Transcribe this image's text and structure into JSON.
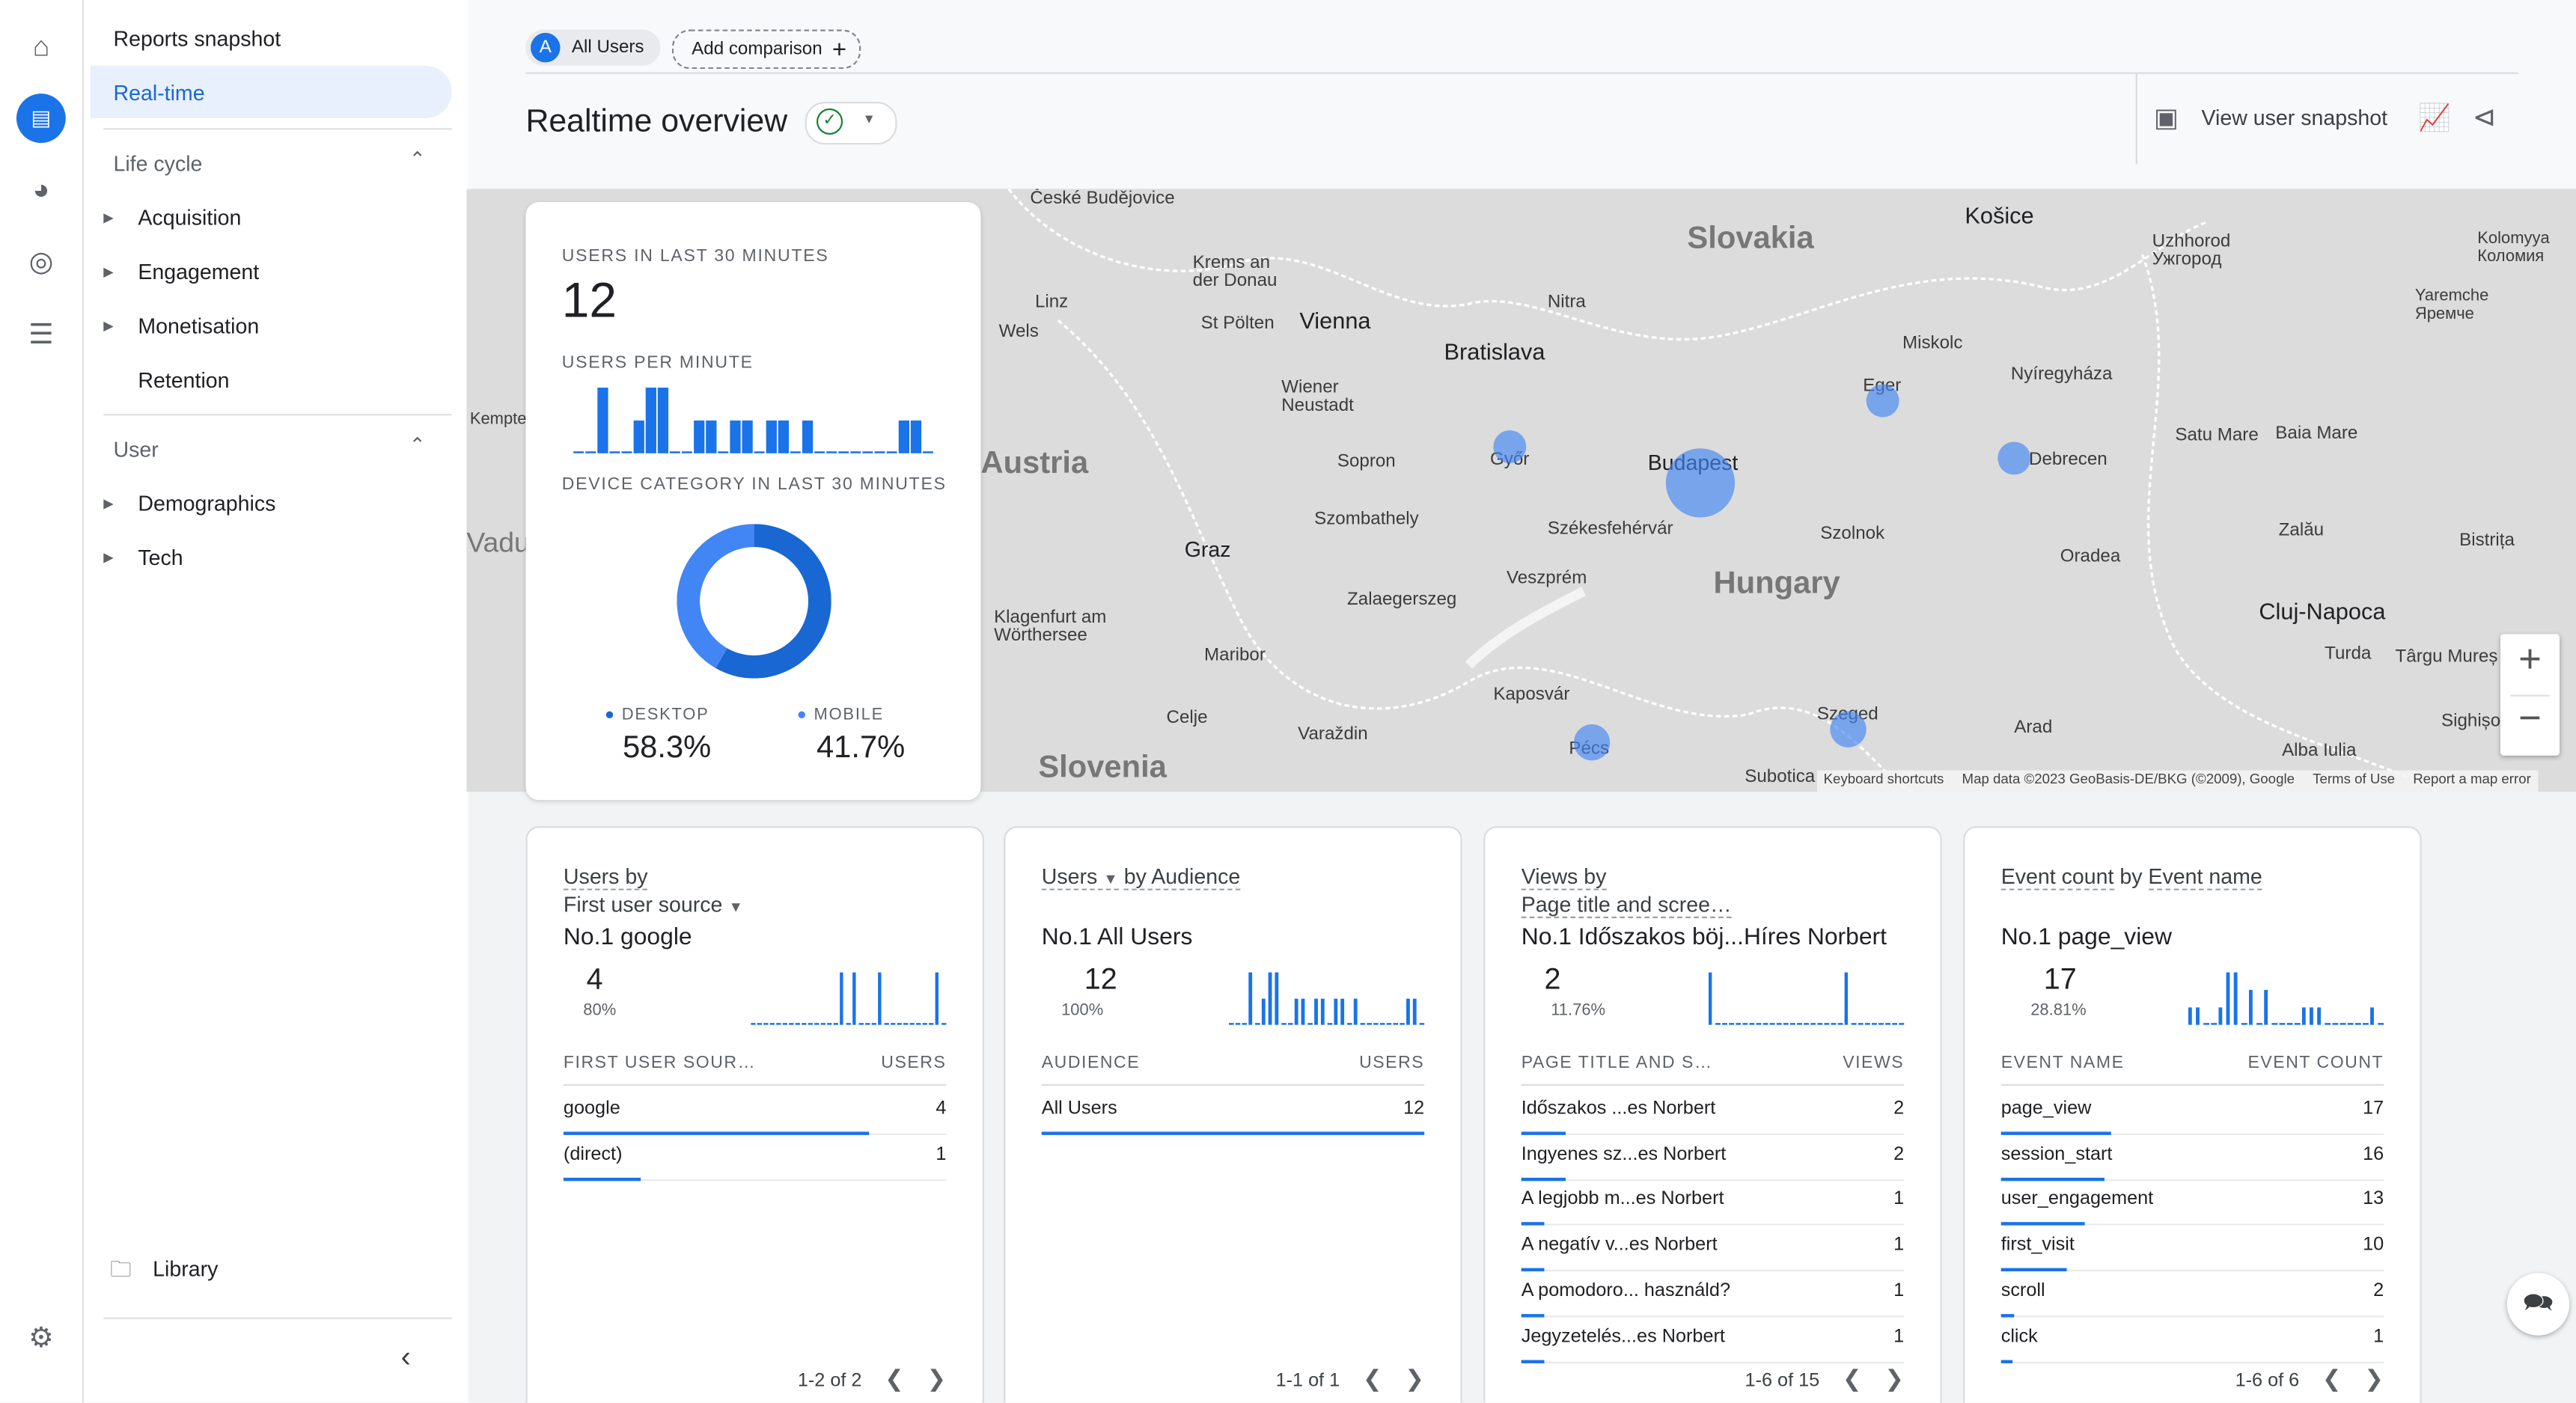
{
  "sidebar": {
    "title": "Reports snapshot",
    "selected": "Real-time",
    "lifecycle": {
      "label": "Life cycle",
      "items": [
        "Acquisition",
        "Engagement",
        "Monetisation",
        "Retention"
      ]
    },
    "user": {
      "label": "User",
      "items": [
        "Demographics",
        "Tech"
      ]
    },
    "library": "Library"
  },
  "header": {
    "comparison_chip": "All Users",
    "chip_letter": "A",
    "add_comparison": "Add comparison",
    "title": "Realtime overview",
    "view_user_snapshot": "View user snapshot"
  },
  "map": {
    "countries": [
      "Slovakia",
      "Austria",
      "Hungary",
      "Slovenia"
    ],
    "cities": [
      "České Budějovice",
      "Krems an der Donau",
      "Linz",
      "Wels",
      "St Pölten",
      "Vienna",
      "Bratislava",
      "Nitra",
      "Košice",
      "Uzhhorod Ужгород",
      "Kolomyya Коломия",
      "Yaremche Яремче",
      "Miskolc",
      "Eger",
      "Nyíregyháza",
      "Wiener Neustadt",
      "Sopron",
      "Győr",
      "Budapest",
      "Debrecen",
      "Satu Mare",
      "Baia Mare",
      "Graz",
      "Szombathely",
      "Székesfehérvár",
      "Szolnok",
      "Oradea",
      "Zalău",
      "Bistrița",
      "Veszprém",
      "Zalaegerszeg",
      "Cluj-Napoca",
      "Klagenfurt am Wörthersee",
      "Maribor",
      "Turda",
      "Târgu Mureș",
      "Kaposvár",
      "Szeged",
      "Arad",
      "Celje",
      "Varaždin",
      "Pécs",
      "Alba Iulia",
      "Sighișoara",
      "Subotica",
      "Kempten",
      "Vaduz"
    ],
    "footer": [
      "Keyboard shortcuts",
      "Map data ©2023 GeoBasis-DE/BKG (©2009), Google",
      "Terms of Use",
      "Report a map error"
    ],
    "bubbles": [
      {
        "city": "Budapest"
      },
      {
        "city": "Győr"
      },
      {
        "city": "Eger"
      },
      {
        "city": "Debrecen"
      },
      {
        "city": "Szeged"
      },
      {
        "city": "Pécs"
      }
    ]
  },
  "overview": {
    "users_label": "USERS IN LAST 30 MINUTES",
    "users_value": "12",
    "per_minute_label": "USERS PER MINUTE",
    "per_minute": [
      0,
      0,
      2,
      0,
      0,
      1,
      2,
      2,
      0,
      0,
      1,
      1,
      0,
      1,
      1,
      0,
      1,
      1,
      0,
      1,
      0,
      0,
      0,
      0,
      0,
      0,
      0,
      1,
      1,
      0
    ],
    "device_label": "DEVICE CATEGORY IN LAST 30 MINUTES",
    "devices": [
      {
        "name": "DESKTOP",
        "value": "58.3%",
        "share": 58.3,
        "color": "#1967d2"
      },
      {
        "name": "MOBILE",
        "value": "41.7%",
        "share": 41.7,
        "color": "#4285f4"
      }
    ]
  },
  "cards": [
    {
      "title_a": "Users by",
      "title_b": "First user source",
      "no1": "No.1  google",
      "big": "4",
      "pct": "80%",
      "col1": "FIRST USER SOUR…",
      "col2": "USERS",
      "spark": [
        0,
        0,
        0,
        0,
        0,
        0,
        0,
        0,
        0,
        0,
        0,
        0,
        0,
        0,
        1,
        0,
        1,
        0,
        0,
        0,
        1,
        0,
        0,
        0,
        0,
        0,
        0,
        0,
        0,
        1,
        0
      ],
      "rows": [
        {
          "name": "google",
          "value": "4",
          "share": 0.8
        },
        {
          "name": "(direct)",
          "value": "1",
          "share": 0.2
        }
      ],
      "pagination": "1-2 of 2"
    },
    {
      "title_a": "Users",
      "title_b": "by Audience",
      "no1": "No.1  All Users",
      "big": "12",
      "pct": "100%",
      "col1": "AUDIENCE",
      "col2": "USERS",
      "spark": [
        0,
        0,
        0,
        2,
        0,
        1,
        2,
        2,
        0,
        0,
        1,
        1,
        0,
        1,
        1,
        0,
        1,
        1,
        0,
        1,
        0,
        0,
        0,
        0,
        0,
        0,
        0,
        1,
        1,
        0
      ],
      "rows": [
        {
          "name": "All Users",
          "value": "12",
          "share": 1
        }
      ],
      "pagination": "1-1 of 1"
    },
    {
      "title_a": "Views by",
      "title_b": "Page title and scree…",
      "no1": "No.1  Időszakos böj...Híres Norbert",
      "big": "2",
      "pct": "11.76%",
      "col1": "PAGE TITLE AND S…",
      "col2": "VIEWS",
      "spark": [
        1,
        0,
        0,
        0,
        0,
        0,
        0,
        0,
        0,
        0,
        0,
        0,
        0,
        0,
        0,
        0,
        0,
        0,
        0,
        0,
        1,
        0,
        0,
        0,
        0,
        0,
        0,
        0,
        0
      ],
      "rows": [
        {
          "name": "Időszakos ...es Norbert",
          "value": "2",
          "share": 0.118
        },
        {
          "name": "Ingyenes sz...es Norbert",
          "value": "2",
          "share": 0.118
        },
        {
          "name": "A legjobb m...es Norbert",
          "value": "1",
          "share": 0.059
        },
        {
          "name": "A negatív v...es Norbert",
          "value": "1",
          "share": 0.059
        },
        {
          "name": "A pomodoro... használd?",
          "value": "1",
          "share": 0.059
        },
        {
          "name": "Jegyzetelés...es Norbert",
          "value": "1",
          "share": 0.059
        }
      ],
      "pagination": "1-6 of 15"
    },
    {
      "title_a": "Event count",
      "title_b": "Event name",
      "no1": "No.1  page_view",
      "big": "17",
      "pct": "28.81%",
      "col1": "EVENT NAME",
      "col2": "EVENT COUNT",
      "spark": [
        1,
        1,
        0,
        0,
        1,
        3,
        3,
        0,
        2,
        0,
        2,
        0,
        0,
        0,
        0,
        1,
        1,
        1,
        0,
        0,
        0,
        0,
        0,
        0,
        1,
        0
      ],
      "rows": [
        {
          "name": "page_view",
          "value": "17",
          "share": 0.288
        },
        {
          "name": "session_start",
          "value": "16",
          "share": 0.271
        },
        {
          "name": "user_engagement",
          "value": "13",
          "share": 0.22
        },
        {
          "name": "first_visit",
          "value": "10",
          "share": 0.17
        },
        {
          "name": "scroll",
          "value": "2",
          "share": 0.034
        },
        {
          "name": "click",
          "value": "1",
          "share": 0.017
        }
      ],
      "pagination": "1-6 of 6"
    }
  ]
}
